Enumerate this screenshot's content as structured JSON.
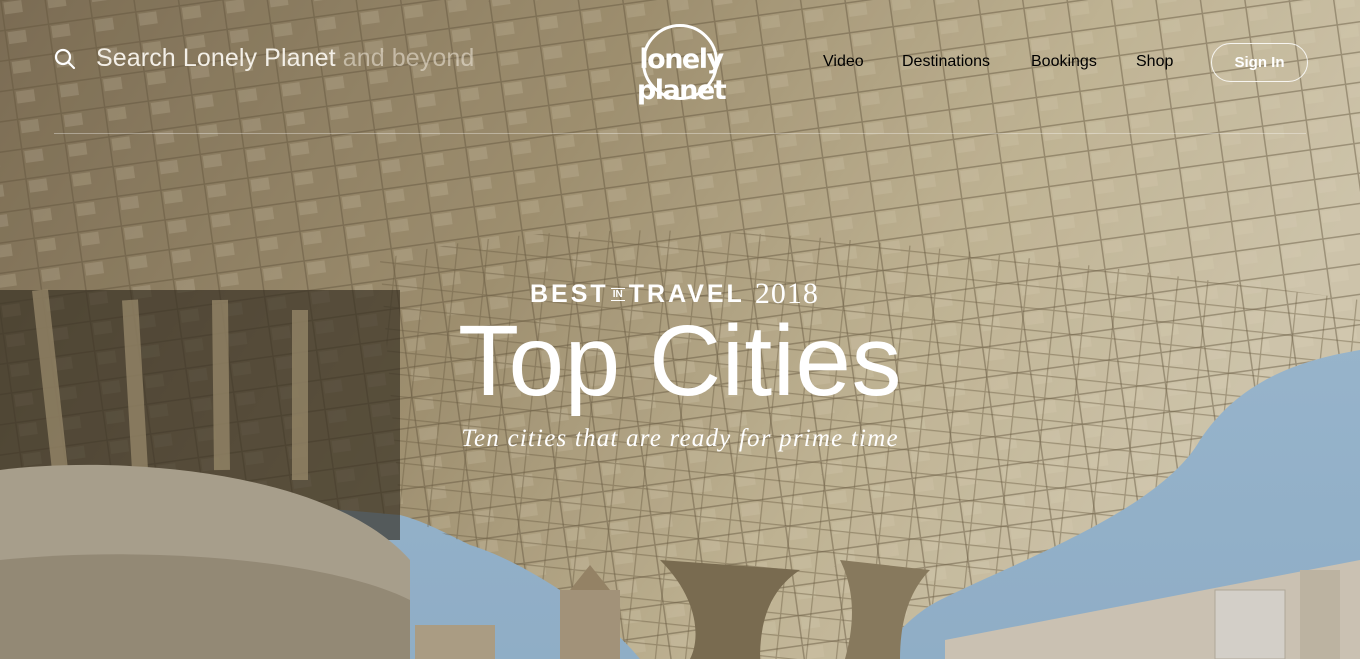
{
  "search": {
    "prefix": "Search Lonely Planet",
    "suffix": "and beyond"
  },
  "logo": {
    "text": "lonely planet"
  },
  "nav": {
    "items": [
      {
        "label": "Video"
      },
      {
        "label": "Destinations"
      },
      {
        "label": "Bookings"
      },
      {
        "label": "Shop"
      }
    ],
    "sign_in": "Sign In"
  },
  "hero": {
    "kicker_best": "BEST",
    "kicker_in": "IN",
    "kicker_travel": "TRAVEL",
    "kicker_year": "2018",
    "title": "Top Cities",
    "subtitle": "Ten cities that are ready for prime time"
  },
  "colors": {
    "sky": "#a9cbe6",
    "structure_light": "#e3d5b5",
    "structure_dark": "#6d5f47"
  }
}
